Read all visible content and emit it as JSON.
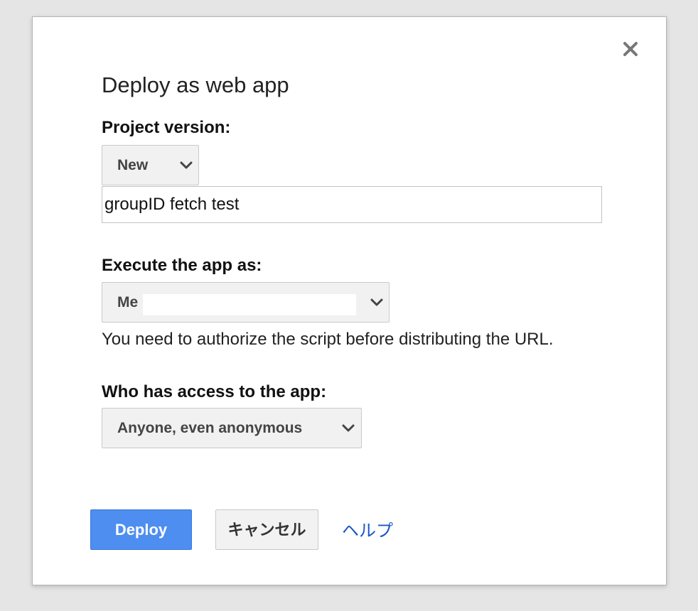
{
  "dialog": {
    "title": "Deploy as web app",
    "close_icon": "close-icon"
  },
  "project_version": {
    "label": "Project version:",
    "selected": "New",
    "description_value": "groupID fetch test"
  },
  "execute_as": {
    "label": "Execute the app as:",
    "selected": "Me",
    "note": "You need to authorize the script before distributing the URL."
  },
  "access": {
    "label": "Who has access to the app:",
    "selected": "Anyone, even anonymous"
  },
  "buttons": {
    "deploy": "Deploy",
    "cancel": "キャンセル",
    "help": "ヘルプ"
  },
  "colors": {
    "primary": "#4d8ef0",
    "link": "#1a56c9"
  }
}
